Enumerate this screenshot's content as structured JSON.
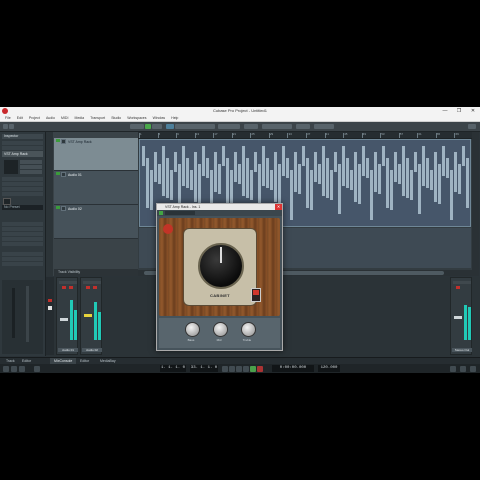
{
  "window": {
    "title": "Cubase Pro Project - Untitled1",
    "controls": [
      "—",
      "❐",
      "✕"
    ]
  },
  "menu": [
    "File",
    "Edit",
    "Project",
    "Audio",
    "MIDI",
    "Media",
    "Transport",
    "Studio",
    "Workspaces",
    "Window",
    "Help"
  ],
  "inspector": {
    "header": "Inspector",
    "track_name": "VST Amp Rack",
    "preset": "No Preset"
  },
  "tracks": [
    {
      "name": "VST Amp Rack"
    },
    {
      "name": "Audio 01"
    },
    {
      "name": "Audio 02"
    }
  ],
  "track_footer": "Track Visibility",
  "ruler_numbers": [
    "1",
    "5",
    "9",
    "13",
    "17",
    "21",
    "25",
    "29",
    "33",
    "37",
    "41",
    "45",
    "49",
    "53",
    "57",
    "61",
    "65",
    "69"
  ],
  "plugin": {
    "title": "VST Amp Rack - Ins. 1",
    "brand": "CABINET",
    "knob_labels": [
      "Bass",
      "Mid",
      "Treble"
    ]
  },
  "mixer": {
    "strips": [
      {
        "name": "Audio 01"
      },
      {
        "name": "Audio 02"
      },
      {
        "name": "Stereo Out"
      }
    ],
    "meter_levels": [
      0.8,
      0.6,
      0.75,
      0.55,
      0.7,
      0.65
    ]
  },
  "zone_tabs": [
    "Track",
    "Editor",
    "MixConsole",
    "Editor",
    "MediaBay"
  ],
  "transport": {
    "position_left": "1. 1. 1. 0",
    "position_right": "33. 1. 1. 0",
    "primary_time": "0:00:00.000",
    "tempo": "120.000"
  },
  "colors": {
    "accent_green": "#4aa84a",
    "meter_teal": "#21c9b6",
    "close_red": "#d33"
  }
}
